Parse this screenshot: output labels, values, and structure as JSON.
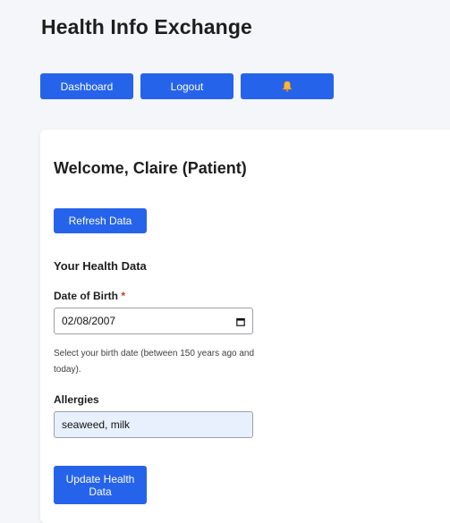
{
  "header": {
    "title": "Health Info Exchange"
  },
  "nav": {
    "dashboard_label": "Dashboard",
    "logout_label": "Logout",
    "notifications_icon": "bell-icon"
  },
  "main": {
    "welcome": "Welcome, Claire (Patient)",
    "refresh_label": "Refresh Data",
    "section_title": "Your Health Data",
    "dob": {
      "label": "Date of Birth",
      "required_mark": "*",
      "value": "02/08/2007",
      "hint": "Select your birth date (between 150 years ago and today)."
    },
    "allergies": {
      "label": "Allergies",
      "value": "seaweed, milk"
    },
    "update_label": "Update Health Data"
  },
  "colors": {
    "accent": "#2563eb",
    "background": "#f4f6f9",
    "card": "#ffffff",
    "autofill": "#e8f0fe",
    "required": "#d93025"
  }
}
